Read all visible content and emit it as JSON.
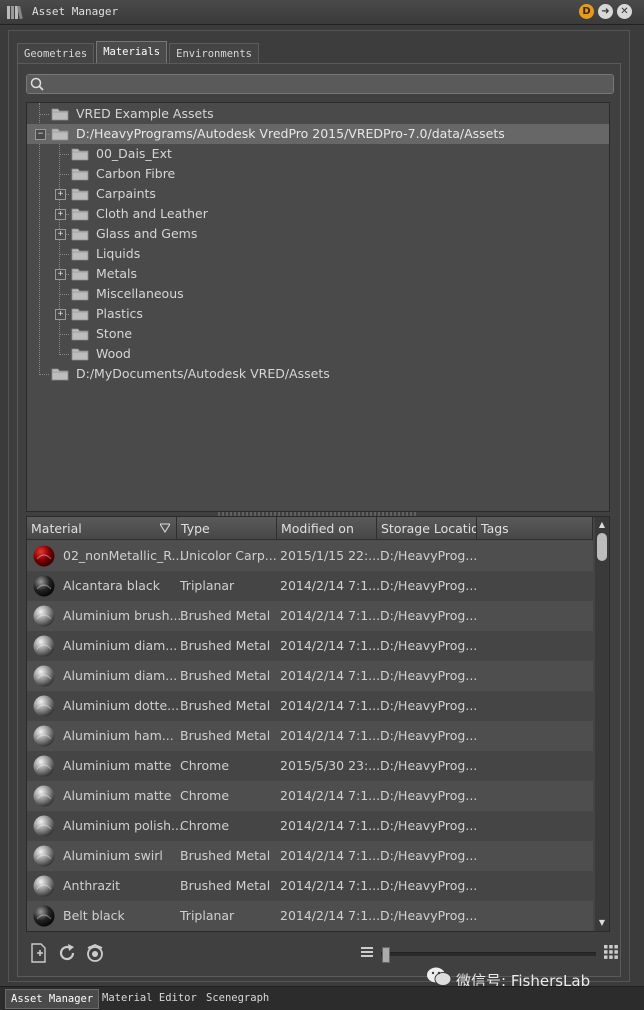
{
  "window": {
    "title": "Asset Manager",
    "badge_letter": "D"
  },
  "tabs": [
    {
      "label": "Geometries",
      "active": false
    },
    {
      "label": "Materials",
      "active": true
    },
    {
      "label": "Environments",
      "active": false
    }
  ],
  "search": {
    "value": "",
    "placeholder": ""
  },
  "tree": {
    "items": [
      {
        "label": "VRED Example Assets",
        "expander": ""
      },
      {
        "label": "D:/HeavyPrograms/Autodesk VredPro 2015/VREDPro-7.0/data/Assets",
        "expander": "−",
        "selected": true
      },
      {
        "label": "00_Dais_Ext",
        "expander": ""
      },
      {
        "label": "Carbon Fibre",
        "expander": ""
      },
      {
        "label": "Carpaints",
        "expander": "+"
      },
      {
        "label": "Cloth and Leather",
        "expander": "+"
      },
      {
        "label": "Glass and Gems",
        "expander": "+"
      },
      {
        "label": "Liquids",
        "expander": ""
      },
      {
        "label": "Metals",
        "expander": "+"
      },
      {
        "label": "Miscellaneous",
        "expander": ""
      },
      {
        "label": "Plastics",
        "expander": "+"
      },
      {
        "label": "Stone",
        "expander": ""
      },
      {
        "label": "Wood",
        "expander": ""
      },
      {
        "label": "D:/MyDocuments/Autodesk VRED/Assets",
        "expander": ""
      }
    ]
  },
  "table": {
    "columns": [
      "Material",
      "Type",
      "Modified on",
      "Storage Locatio",
      "Tags"
    ],
    "rows": [
      {
        "material": "02_nonMetallic_R...",
        "type": "Unicolor Carp...",
        "modified": "2015/1/15 22:...",
        "storage": "D:/HeavyProg...",
        "tags": "",
        "icon": "red-paint-sphere-icon"
      },
      {
        "material": "Alcantara black",
        "type": "Triplanar",
        "modified": "2014/2/14 7:1...",
        "storage": "D:/HeavyProg...",
        "tags": "",
        "icon": "dark-sphere-icon"
      },
      {
        "material": "Aluminium brush...",
        "type": "Brushed Metal",
        "modified": "2014/2/14 7:1...",
        "storage": "D:/HeavyProg...",
        "tags": "",
        "icon": "metal-sphere-icon"
      },
      {
        "material": "Aluminium diam...",
        "type": "Brushed Metal",
        "modified": "2014/2/14 7:1...",
        "storage": "D:/HeavyProg...",
        "tags": "",
        "icon": "metal-sphere-icon"
      },
      {
        "material": "Aluminium diam...",
        "type": "Brushed Metal",
        "modified": "2014/2/14 7:1...",
        "storage": "D:/HeavyProg...",
        "tags": "",
        "icon": "metal-sphere-icon"
      },
      {
        "material": "Aluminium dotte...",
        "type": "Brushed Metal",
        "modified": "2014/2/14 7:1...",
        "storage": "D:/HeavyProg...",
        "tags": "",
        "icon": "metal-sphere-icon"
      },
      {
        "material": "Aluminium ham...",
        "type": "Brushed Metal",
        "modified": "2014/2/14 7:1...",
        "storage": "D:/HeavyProg...",
        "tags": "",
        "icon": "metal-sphere-icon"
      },
      {
        "material": "Aluminium matte",
        "type": "Chrome",
        "modified": "2015/5/30 23:...",
        "storage": "D:/HeavyProg...",
        "tags": "",
        "icon": "metal-sphere-icon"
      },
      {
        "material": "Aluminium matte",
        "type": "Chrome",
        "modified": "2014/2/14 7:1...",
        "storage": "D:/HeavyProg...",
        "tags": "",
        "icon": "metal-sphere-icon"
      },
      {
        "material": "Aluminium polish...",
        "type": "Chrome",
        "modified": "2014/2/14 7:1...",
        "storage": "D:/HeavyProg...",
        "tags": "",
        "icon": "metal-sphere-icon"
      },
      {
        "material": "Aluminium swirl",
        "type": "Brushed Metal",
        "modified": "2014/2/14 7:1...",
        "storage": "D:/HeavyProg...",
        "tags": "",
        "icon": "metal-sphere-icon"
      },
      {
        "material": "Anthrazit",
        "type": "Brushed Metal",
        "modified": "2014/2/14 7:1...",
        "storage": "D:/HeavyProg...",
        "tags": "",
        "icon": "metal-sphere-icon"
      },
      {
        "material": "Belt black",
        "type": "Triplanar",
        "modified": "2014/2/14 7:1...",
        "storage": "D:/HeavyProg...",
        "tags": "",
        "icon": "dark-sphere-icon"
      }
    ]
  },
  "watermark": {
    "text": "微信号: FishersLab"
  },
  "bottom_tabs": [
    {
      "label": "Asset Manager",
      "active": true
    },
    {
      "label": "Material Editor",
      "active": false
    },
    {
      "label": "Scenegraph",
      "active": false
    }
  ],
  "colors": {
    "accent_badge": "#e79a1e",
    "selected_row": "#676767",
    "panel_bg": "#3b3b3b"
  }
}
